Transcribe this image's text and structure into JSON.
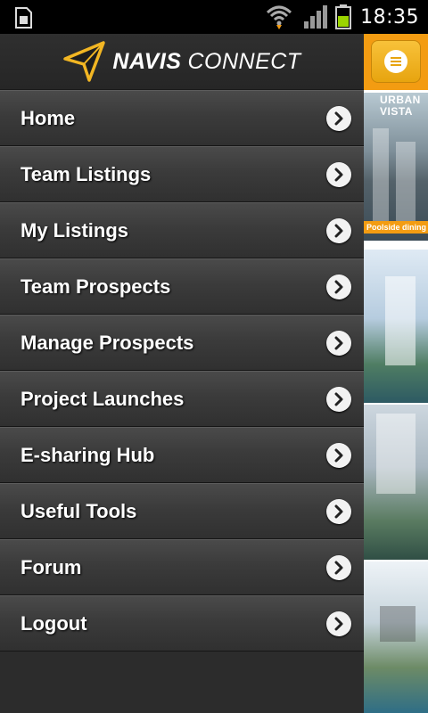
{
  "status_bar": {
    "time": "18:35",
    "icons": [
      "sim-card-icon",
      "wifi-icon",
      "signal-icon",
      "battery-icon"
    ]
  },
  "drawer": {
    "logo": {
      "brand_bold": "NAVIS",
      "brand_light": "CONNECT"
    },
    "menu": [
      {
        "label": "Home"
      },
      {
        "label": "Team Listings"
      },
      {
        "label": "My Listings"
      },
      {
        "label": "Team Prospects"
      },
      {
        "label": "Manage Prospects"
      },
      {
        "label": "Project Launches"
      },
      {
        "label": "E-sharing Hub"
      },
      {
        "label": "Useful Tools"
      },
      {
        "label": "Forum"
      },
      {
        "label": "Logout"
      }
    ]
  },
  "content": {
    "banner": {
      "brand_line1": "URBAN",
      "brand_line2": "VISTA",
      "caption": "Poolside dining"
    }
  },
  "colors": {
    "accent": "#f39c12",
    "drawer_bg": "#2c2c2c",
    "item_text": "#ffffff"
  }
}
